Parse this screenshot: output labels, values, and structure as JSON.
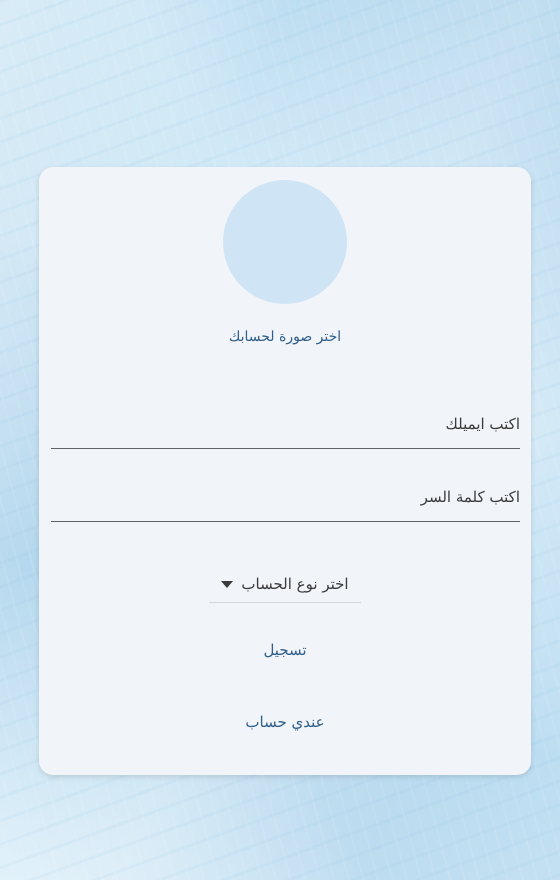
{
  "form": {
    "choose_photo_label": "اختر صورة لحسابك",
    "email_placeholder": "اكتب ايميلك",
    "email_value": "",
    "password_placeholder": "اكتب كلمة السر",
    "password_value": "",
    "account_type_label": "اختر نوع الحساب",
    "register_label": "تسجيل",
    "have_account_label": "عندي حساب"
  },
  "colors": {
    "background": "#c9e4f3",
    "card": "#f1f4f8",
    "avatar": "#cfe5f6",
    "link_text": "#2f5f8a"
  },
  "icons": {
    "dropdown": "caret-down-icon"
  }
}
